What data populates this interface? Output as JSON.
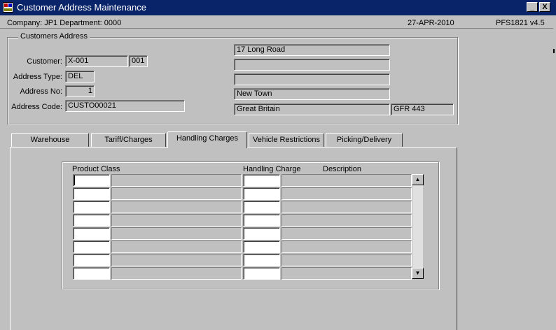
{
  "window": {
    "title": "Customer Address Maintenance",
    "minimize_glyph": "_",
    "close_glyph": "X"
  },
  "info": {
    "company": "Company:  JP1   Department:  0000",
    "date": "27-APR-2010",
    "version": "PFS1821  v4.5"
  },
  "group": {
    "title": "Customers Address"
  },
  "form": {
    "customer_label": "Customer:",
    "customer_value": "X-001",
    "customer_suffix": "001",
    "address_type_label": "Address Type:",
    "address_type_value": "DEL",
    "address_no_label": "Address No:",
    "address_no_value": "1",
    "address_code_label": "Address Code:",
    "address_code_value": "CUSTO00021",
    "address_lines": [
      "17 Long Road",
      "",
      "",
      "New Town"
    ],
    "country": "Great Britain",
    "postcode": "GFR 443"
  },
  "tabs": [
    {
      "label": "Warehouse"
    },
    {
      "label": "Tariff/Charges"
    },
    {
      "label": "Handling Charges"
    },
    {
      "label": "Vehicle  Restrictions"
    },
    {
      "label": "Picking/Delivery"
    }
  ],
  "active_tab": "Handling Charges",
  "grid": {
    "headers": {
      "product_class": "Product Class",
      "handling_charge": "Handling Charge",
      "description": "Description"
    },
    "rows": [
      {
        "class_code": "",
        "class_desc": "",
        "charge_code": "",
        "charge_desc": ""
      },
      {
        "class_code": "",
        "class_desc": "",
        "charge_code": "",
        "charge_desc": ""
      },
      {
        "class_code": "",
        "class_desc": "",
        "charge_code": "",
        "charge_desc": ""
      },
      {
        "class_code": "",
        "class_desc": "",
        "charge_code": "",
        "charge_desc": ""
      },
      {
        "class_code": "",
        "class_desc": "",
        "charge_code": "",
        "charge_desc": ""
      },
      {
        "class_code": "",
        "class_desc": "",
        "charge_code": "",
        "charge_desc": ""
      },
      {
        "class_code": "",
        "class_desc": "",
        "charge_code": "",
        "charge_desc": ""
      },
      {
        "class_code": "",
        "class_desc": "",
        "charge_code": "",
        "charge_desc": ""
      }
    ]
  },
  "scrollbar": {
    "up_glyph": "▲",
    "down_glyph": "▼"
  }
}
